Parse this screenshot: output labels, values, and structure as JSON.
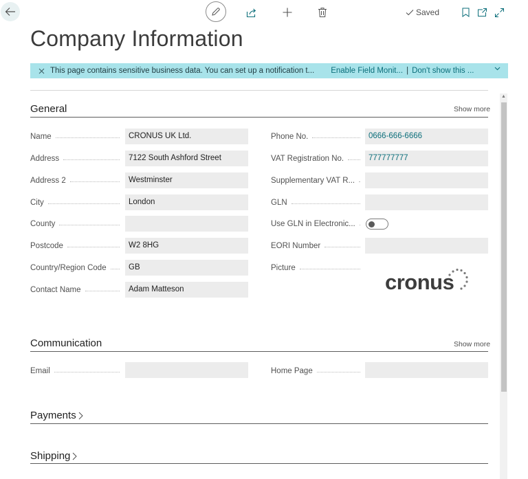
{
  "toolbar": {
    "saved_label": "Saved"
  },
  "page": {
    "title": "Company Information"
  },
  "notification": {
    "message": "This page contains sensitive business data. You can set up a notification t...",
    "action_enable": "Enable Field Monit...",
    "separator": "|",
    "action_dismiss": "Don't show this ..."
  },
  "general": {
    "title": "General",
    "show_more": "Show more",
    "left": [
      {
        "label": "Name",
        "value": "CRONUS UK Ltd."
      },
      {
        "label": "Address",
        "value": "7122 South Ashford Street"
      },
      {
        "label": "Address 2",
        "value": "Westminster"
      },
      {
        "label": "City",
        "value": "London"
      },
      {
        "label": "County",
        "value": ""
      },
      {
        "label": "Postcode",
        "value": "W2 8HG"
      },
      {
        "label": "Country/Region Code",
        "value": "GB"
      },
      {
        "label": "Contact Name",
        "value": "Adam Matteson"
      }
    ],
    "right": [
      {
        "label": "Phone No.",
        "value": "0666-666-6666"
      },
      {
        "label": "VAT Registration No.",
        "value": "777777777"
      },
      {
        "label": "Supplementary VAT R...",
        "value": ""
      },
      {
        "label": "GLN",
        "value": ""
      },
      {
        "label": "Use GLN in Electronic...",
        "value": false
      },
      {
        "label": "EORI Number",
        "value": ""
      },
      {
        "label": "Picture",
        "value": "cronus"
      }
    ]
  },
  "communication": {
    "title": "Communication",
    "show_more": "Show more",
    "email_label": "Email",
    "email_value": "",
    "home_page_label": "Home Page",
    "home_page_value": ""
  },
  "payments": {
    "title": "Payments"
  },
  "shipping": {
    "title": "Shipping"
  },
  "colors": {
    "accent": "#0b6e7a",
    "notification_bg": "#a8e3ea",
    "field_bg": "#ececec"
  }
}
